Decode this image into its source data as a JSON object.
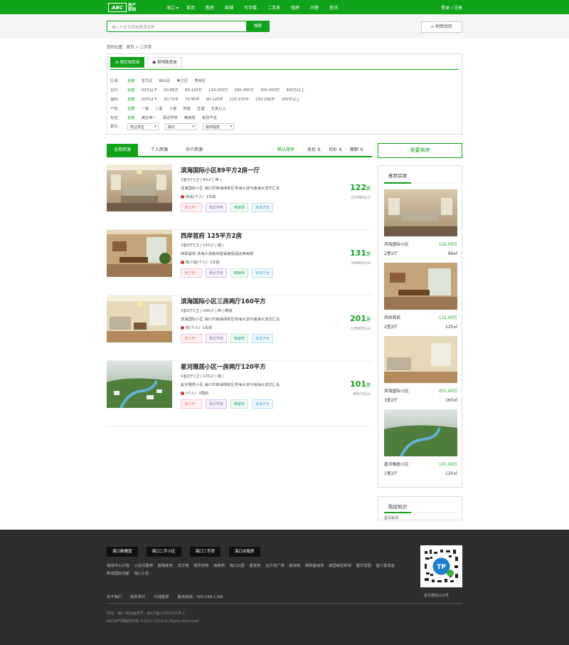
{
  "header": {
    "logo_mark": "ABC",
    "logo_line1": "房产",
    "logo_line2": "家网",
    "city": "海口",
    "nav": [
      "首页",
      "新房",
      "商铺",
      "写字楼",
      "二手房",
      "租房",
      "问答",
      "资讯"
    ],
    "login": "登录 / 注册"
  },
  "search": {
    "placeholder": "输入小区名称或房源名称",
    "button": "搜索",
    "map_button": "地图找房"
  },
  "breadcrumb": "您的位置：首页 > 二手房",
  "filter": {
    "tabs": [
      "按区域查询",
      "按地铁查询"
    ],
    "rows": [
      {
        "label": "区域:",
        "options": [
          "全部",
          "龙华区",
          "琼山区",
          "美兰区",
          "秀英区"
        ]
      },
      {
        "label": "总价:",
        "options": [
          "全部",
          "50万以下",
          "50-80万",
          "80-120万",
          "120-200万",
          "200-300万",
          "300-400万",
          "400万以上"
        ]
      },
      {
        "label": "面积:",
        "options": [
          "全部",
          "50平以下",
          "50-70平",
          "70-90平",
          "90-120平",
          "120-150平",
          "150-200平",
          "200平以上"
        ]
      },
      {
        "label": "户型:",
        "options": [
          "全部",
          "一室",
          "二室",
          "三室",
          "四室",
          "五室",
          "五室以上"
        ]
      },
      {
        "label": "标签:",
        "options": [
          "全部",
          "满五唯一",
          "靠近学校",
          "精装修",
          "家具齐全"
        ]
      }
    ],
    "more_label": "更多:",
    "selects": [
      "物业类型",
      "朝向",
      "装修程度"
    ]
  },
  "list_tabs": [
    "全部房源",
    "个人房源",
    "中介房源"
  ],
  "sorts": [
    "默认排序",
    "总价 ⇅",
    "均价 ⇅",
    "面积 ⇅"
  ],
  "listings": [
    {
      "title": "滨海国际小区89平方2房一厅",
      "info": "2室1厅1卫  |  89㎡  |  西  |",
      "addr": "滨海国际小区  海口市西海岸新区粤海大道与南海大道交汇处",
      "agent": "陈铭(个人)",
      "time": "1年前",
      "tags": [
        "满五唯一",
        "靠近学校",
        "精装修",
        "家具齐全"
      ],
      "price": "122",
      "unit_label": "万",
      "unit_price": "13708元/㎡"
    },
    {
      "title": "西岸首府 125平方2房",
      "info": "2室2厅1卫  |  125㎡  |  南  |",
      "addr": "西岸首府  滨海大道南来登喜度假酒店西南侧",
      "agent": "陈小姐(个人)",
      "time": "1年前",
      "tags": [
        "满五唯一",
        "靠近学校",
        "精装修",
        "家具齐全"
      ],
      "price": "131",
      "unit_label": "万",
      "unit_price": "10480元/㎡"
    },
    {
      "title": "滨海国际小区三房两厅160平方",
      "info": "3室2厅1卫  |  160㎡  |  西  |  精装",
      "addr": "滨海国际小区  海口市西海岸新区粤海大道与南海大道交汇处",
      "agent": "陈(个人)",
      "time": "1年前",
      "tags": [
        "满五唯一",
        "靠近学校",
        "精装修",
        "家具齐全"
      ],
      "price": "201",
      "unit_label": "万",
      "unit_price": "12563元/㎡"
    },
    {
      "title": "星河雅居小区一房两厅120平方",
      "info": "1室2厅1卫  |  120㎡  |  南  |",
      "addr": "星河雅居小区  海口市西海岸新区粤海大道与南海大道交汇处",
      "agent": "(个人)",
      "time": "3周前",
      "tags": [
        "满五唯一",
        "靠近学校",
        "精装修",
        "家具齐全"
      ],
      "price": "101",
      "unit_label": "万",
      "unit_price": "8417元/㎡"
    }
  ],
  "sell_button": "我要卖房",
  "recommend": {
    "title": "推荐房源",
    "items": [
      {
        "name": "滨海国际小区",
        "price": "122.00万",
        "layout": "2室1厅",
        "area": "89㎡"
      },
      {
        "name": "西岸首府",
        "price": "131.00万",
        "layout": "2室2厅",
        "area": "125㎡"
      },
      {
        "name": "滨海国际小区",
        "price": "201.00万",
        "layout": "3室2厅",
        "area": "160㎡"
      },
      {
        "name": "星河雅居小区",
        "price": "101.00万",
        "layout": "1室2厅",
        "area": "120㎡"
      }
    ]
  },
  "knowledge": {
    "title": "购房知识",
    "line": "首页新闻"
  },
  "footer": {
    "buttons": [
      "海口新楼盘",
      "海口二手小区",
      "海口二手房",
      "海口出租房"
    ],
    "links": [
      "瑞城丰山公馆",
      "三亚凤凰苑",
      "蓝梅家苑",
      "龙华苑",
      "城市佳苑",
      "海南苑",
      "海口公园",
      "香泉苑",
      "五月花广场",
      "碧海苑",
      "南新碧海苑",
      "南国威尼斯城",
      "碧华佳园",
      "富力首溪谷",
      "新城国际花都",
      "海口小区"
    ],
    "bottom": [
      "关于我们",
      "联系我们",
      "代理登录",
      "服务热线：400-168-1168"
    ],
    "qr_caption": "官方微信公众号",
    "qr_text": "TP",
    "copy1": "地址：海口  网站备案号：琼ICP备17001501号-1",
    "copy2": "ABC房产网版权所有 ©2017-2019 All Rights Reserved"
  },
  "colors": {
    "brand": "#0fa31a",
    "footer_bg": "#2e2e2e"
  }
}
